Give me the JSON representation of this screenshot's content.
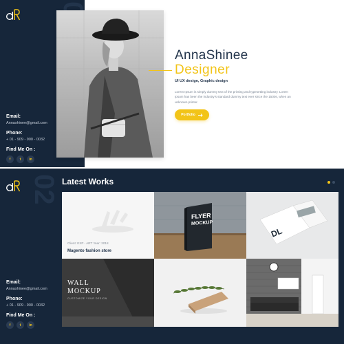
{
  "colors": {
    "navy": "#16263a",
    "accent": "#f2c418",
    "heading": "#22344b",
    "muted": "#7a8594"
  },
  "logo": {
    "text": "R",
    "icon": "logo-icon"
  },
  "hero": {
    "section_number": "01",
    "name": "AnnaShinee",
    "role": "Designer",
    "skills": "UI UX design, Graphic design",
    "description": "Lorem Ipsum is simply dummy text of the printing and typesetting industry. Lorem Ipsum has been the industry's standard dummy text ever since the 1500s, when an unknown printer.",
    "button_label": "Portfolio",
    "button_icon": "arrow-right-icon",
    "photo_icon": "portrait-photo"
  },
  "contact": {
    "email_label": "Email:",
    "email_value": "Annashinee@gmail.com",
    "phone_label": "Phone:",
    "phone_value": "+ 01 - 909 - 900 - 0032",
    "find_label": "Find Me On :",
    "social": [
      {
        "icon": "facebook-icon",
        "glyph": "f"
      },
      {
        "icon": "twitter-icon",
        "glyph": "t"
      },
      {
        "icon": "linkedin-icon",
        "glyph": "in"
      }
    ]
  },
  "works": {
    "section_number": "02",
    "title": "Latest Works",
    "items": [
      {
        "meta": "Client: EXP - ART    Year: 2018",
        "title": "Magento fashion store"
      },
      {
        "title": "FLYER",
        "subtitle": "MOCKUP"
      },
      {
        "title": "DL"
      },
      {
        "title": "WALL",
        "subtitle": "MOCKUP",
        "tagline": "CUSTOMIZE YOUR DESIGN"
      },
      {
        "title": ""
      },
      {
        "title": ""
      }
    ]
  }
}
